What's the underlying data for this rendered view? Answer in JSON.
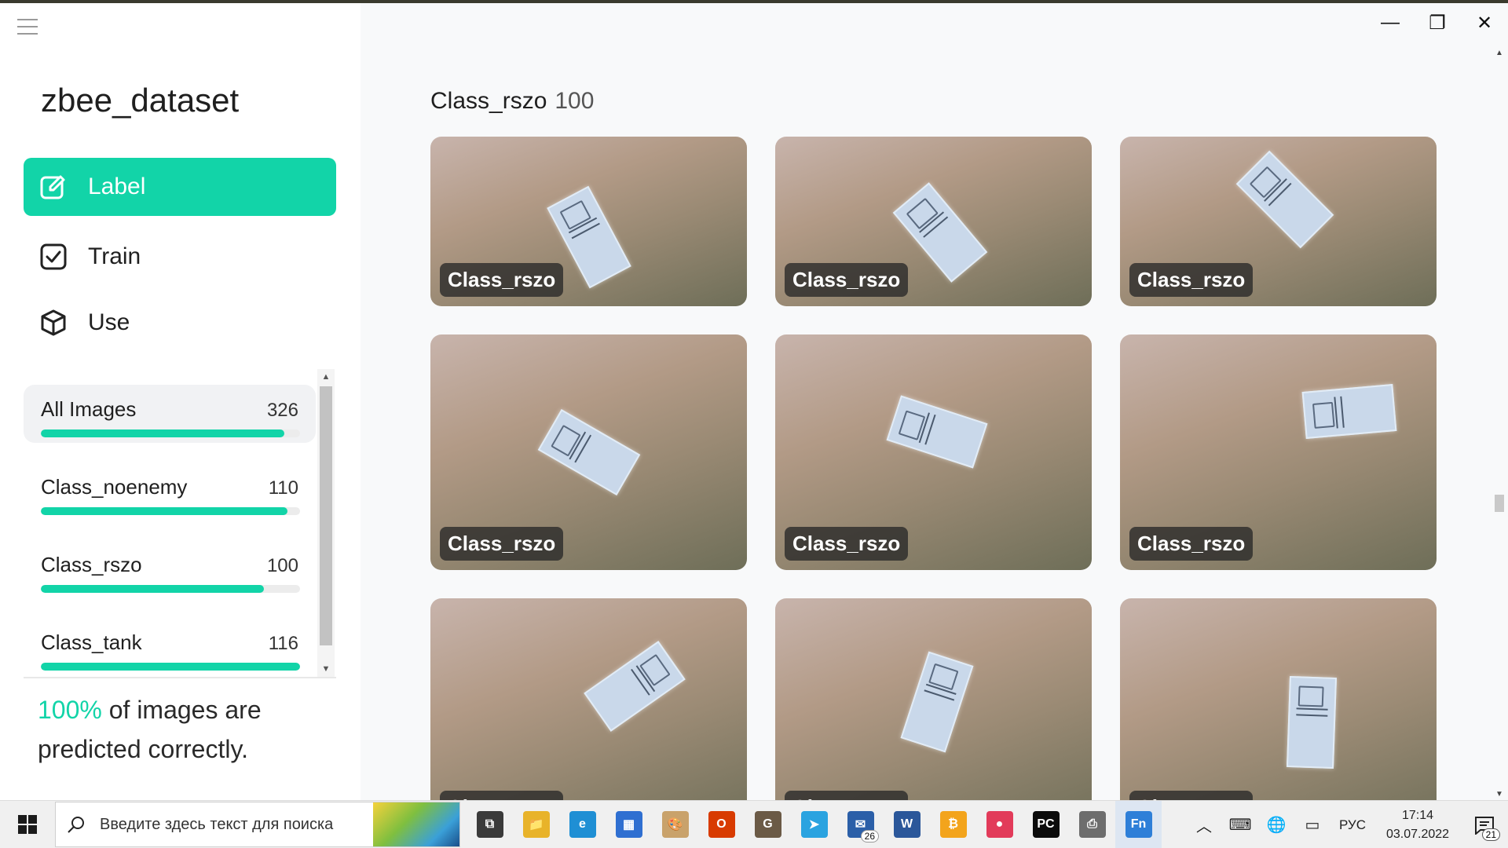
{
  "app": {
    "project_name": "zbee_dataset"
  },
  "nav": {
    "items": [
      {
        "label": "Label",
        "icon": "label-edit-icon",
        "active": true
      },
      {
        "label": "Train",
        "icon": "checkbox-icon",
        "active": false
      },
      {
        "label": "Use",
        "icon": "cube-icon",
        "active": false
      }
    ]
  },
  "classes": {
    "items": [
      {
        "name": "All Images",
        "count": "326",
        "fill": 0.94,
        "selected": true
      },
      {
        "name": "Class_noenemy",
        "count": "110",
        "fill": 0.95,
        "selected": false
      },
      {
        "name": "Class_rszo",
        "count": "100",
        "fill": 0.86,
        "selected": false
      },
      {
        "name": "Class_tank",
        "count": "116",
        "fill": 1.0,
        "selected": false
      }
    ]
  },
  "accuracy": {
    "percent": "100%",
    "line1": " of images are",
    "line2": "predicted correctly."
  },
  "gallery": {
    "title": "Class_rszo",
    "count": "100",
    "cards": [
      {
        "tag": "Class_rszo"
      },
      {
        "tag": "Class_rszo"
      },
      {
        "tag": "Class_rszo"
      },
      {
        "tag": "Class_rszo"
      },
      {
        "tag": "Class_rszo"
      },
      {
        "tag": "Class_rszo"
      },
      {
        "tag": "Class_rszo"
      },
      {
        "tag": "Class_rszo"
      },
      {
        "tag": "Class_rszo"
      }
    ]
  },
  "window": {
    "minimize": "—",
    "restore": "❐",
    "close": "✕"
  },
  "taskbar": {
    "search_placeholder": "Введите здесь текст для поиска",
    "apps": [
      {
        "name": "task-view-icon",
        "glyph": "⧉",
        "color": "#3a3a3a"
      },
      {
        "name": "file-explorer-icon",
        "glyph": "📁",
        "color": "#e8b32a"
      },
      {
        "name": "edge-icon",
        "glyph": "e",
        "color": "#1f8fd4"
      },
      {
        "name": "store-icon",
        "glyph": "▦",
        "color": "#2f6fd1"
      },
      {
        "name": "paint-icon",
        "glyph": "🎨",
        "color": "#c9a26b"
      },
      {
        "name": "office-icon",
        "glyph": "O",
        "color": "#d83b01"
      },
      {
        "name": "gimp-icon",
        "glyph": "G",
        "color": "#6b5a46"
      },
      {
        "name": "telegram-icon",
        "glyph": "➤",
        "color": "#2aa3e0"
      },
      {
        "name": "mail-icon",
        "glyph": "✉",
        "color": "#2b5fa8",
        "badge": "26"
      },
      {
        "name": "word-icon",
        "glyph": "W",
        "color": "#2b579a"
      },
      {
        "name": "bitcoin-wallet-icon",
        "glyph": "₿",
        "color": "#f3a41c"
      },
      {
        "name": "app-dots-icon",
        "glyph": "●",
        "color": "#e23b5a"
      },
      {
        "name": "pycharm-icon",
        "glyph": "PC",
        "color": "#0b0b0b"
      },
      {
        "name": "printer-icon",
        "glyph": "⎙",
        "color": "#6d6d6d"
      },
      {
        "name": "active-app-icon",
        "glyph": "Fn",
        "color": "#2e7fd8",
        "active": true
      }
    ],
    "tray": {
      "lang": "РУС",
      "time": "17:14",
      "date": "03.07.2022",
      "notifications": "21"
    }
  }
}
